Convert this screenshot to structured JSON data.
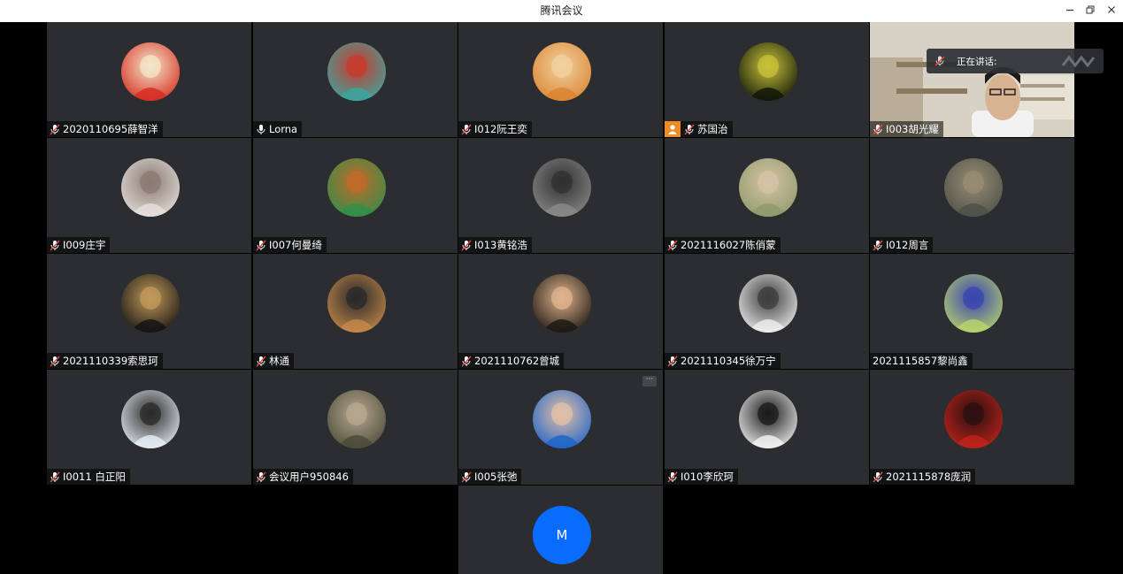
{
  "window": {
    "title": "腾讯会议",
    "minimize_icon": "minimize-icon",
    "restore_icon": "restore-icon",
    "close_icon": "close-icon"
  },
  "speaking_indicator": {
    "label": "正在讲话:"
  },
  "participants": [
    {
      "name": "2020110695薛智洋",
      "mic": "muted",
      "avatar_colors": [
        "#d42a1f",
        "#f5e6c8"
      ]
    },
    {
      "name": "Lorna",
      "mic": "on",
      "avatar_colors": [
        "#3aa6a0",
        "#c83b2e"
      ]
    },
    {
      "name": "I012阮王奕",
      "mic": "muted",
      "avatar_colors": [
        "#d9832f",
        "#f2d1a0"
      ]
    },
    {
      "name": "苏国治",
      "mic": "muted",
      "host": true,
      "avatar_colors": [
        "#0e1408",
        "#c9c23a"
      ]
    },
    {
      "name": "I003胡光耀",
      "mic": "muted",
      "video": true,
      "avatar_colors": [
        "#d8d2c4",
        "#6b5a44"
      ]
    },
    {
      "name": "I009庄宇",
      "mic": "muted",
      "avatar_colors": [
        "#e6e0dc",
        "#8a7a72"
      ]
    },
    {
      "name": "I007何曼绮",
      "mic": "muted",
      "avatar_colors": [
        "#2f8f4a",
        "#c06a2a"
      ]
    },
    {
      "name": "I013黄铭浩",
      "mic": "muted",
      "avatar_colors": [
        "#8a8a8a",
        "#303030"
      ]
    },
    {
      "name": "2021116027陈俏蒙",
      "mic": "muted",
      "avatar_colors": [
        "#8e9a6a",
        "#d6c3a6"
      ]
    },
    {
      "name": "I012周言",
      "mic": "muted",
      "avatar_colors": [
        "#4c5048",
        "#9a8c74"
      ]
    },
    {
      "name": "2021110339索思珂",
      "mic": "muted",
      "avatar_colors": [
        "#121212",
        "#c29a5a"
      ]
    },
    {
      "name": "林通",
      "mic": "muted",
      "avatar_colors": [
        "#c68a4a",
        "#2a2a2a"
      ]
    },
    {
      "name": "2021110762曾城",
      "mic": "muted",
      "avatar_colors": [
        "#1a1410",
        "#e0b48e"
      ]
    },
    {
      "name": "2021110345徐万宁",
      "mic": "muted",
      "avatar_colors": [
        "#f0f0f0",
        "#3c3c3c"
      ]
    },
    {
      "name": "2021115857黎尚鑫",
      "mic": "none",
      "avatar_colors": [
        "#b8d46a",
        "#3a44b0"
      ]
    },
    {
      "name": "I0011 白正阳",
      "mic": "muted",
      "avatar_colors": [
        "#e8f0f6",
        "#2a2a2a"
      ]
    },
    {
      "name": "会议用户950846",
      "mic": "muted",
      "avatar_colors": [
        "#4a4a38",
        "#b8a890"
      ]
    },
    {
      "name": "I005张弛",
      "mic": "muted",
      "more_menu": "···",
      "avatar_colors": [
        "#1d63c8",
        "#e2c0a8"
      ]
    },
    {
      "name": "I010李欣珂",
      "mic": "muted",
      "avatar_colors": [
        "#f4f4f4",
        "#1a1a1a"
      ]
    },
    {
      "name": "2021115878庞润",
      "mic": "muted",
      "avatar_colors": [
        "#c0231a",
        "#2a1010"
      ]
    }
  ],
  "extra_participant": {
    "initial": "M",
    "color": "#0a6cff"
  }
}
